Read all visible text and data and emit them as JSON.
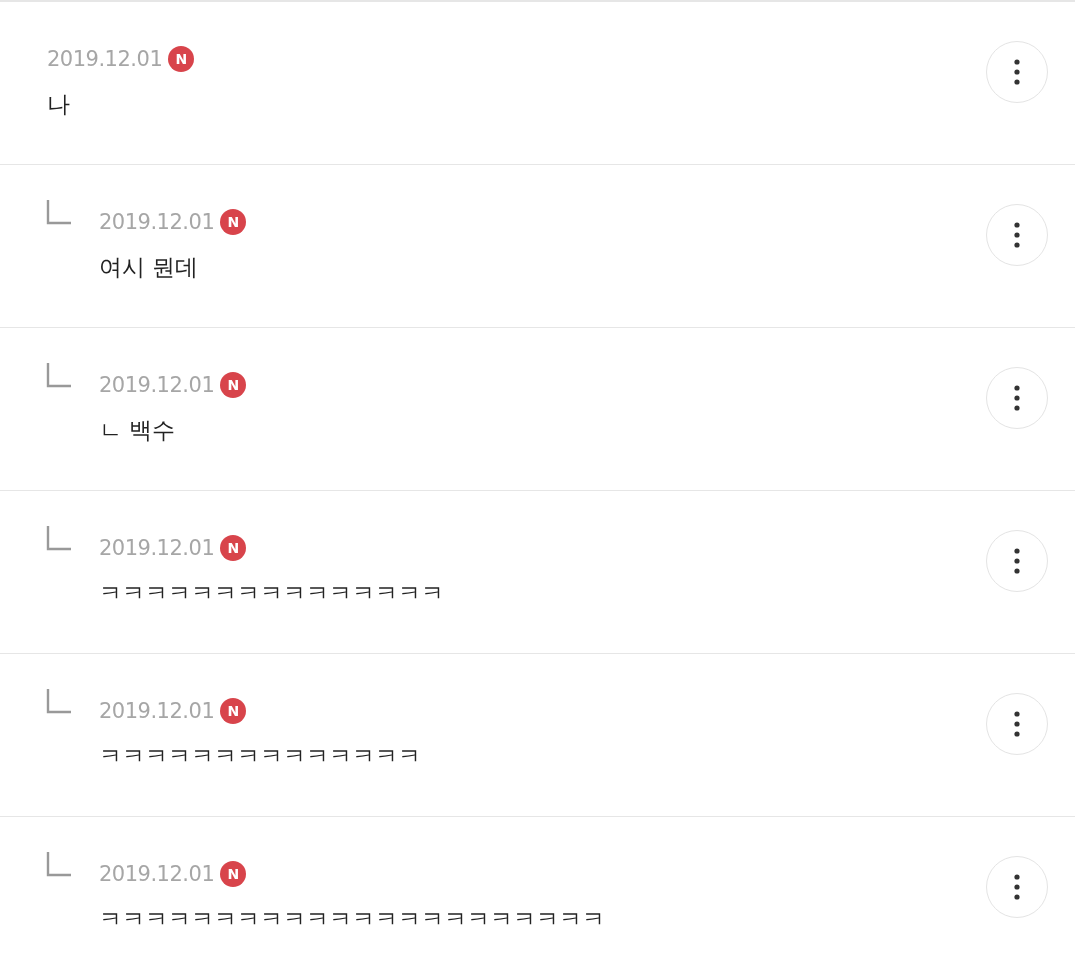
{
  "comments": [
    {
      "kind": "comment",
      "date": "2019.12.01",
      "badge": "N",
      "text": "나"
    },
    {
      "kind": "reply",
      "date": "2019.12.01",
      "badge": "N",
      "text": "여시 뭔데"
    },
    {
      "kind": "reply",
      "date": "2019.12.01",
      "badge": "N",
      "text": "ㄴ 백수"
    },
    {
      "kind": "reply",
      "date": "2019.12.01",
      "badge": "N",
      "text": "ㅋㅋㅋㅋㅋㅋㅋㅋㅋㅋㅋㅋㅋㅋㅋ"
    },
    {
      "kind": "reply",
      "date": "2019.12.01",
      "badge": "N",
      "text": "ㅋㅋㅋㅋㅋㅋㅋㅋㅋㅋㅋㅋㅋㅋ"
    },
    {
      "kind": "reply",
      "date": "2019.12.01",
      "badge": "N",
      "text": "ㅋㅋㅋㅋㅋㅋㅋㅋㅋㅋㅋㅋㅋㅋㅋㅋㅋㅋㅋㅋㅋㅋ"
    }
  ]
}
